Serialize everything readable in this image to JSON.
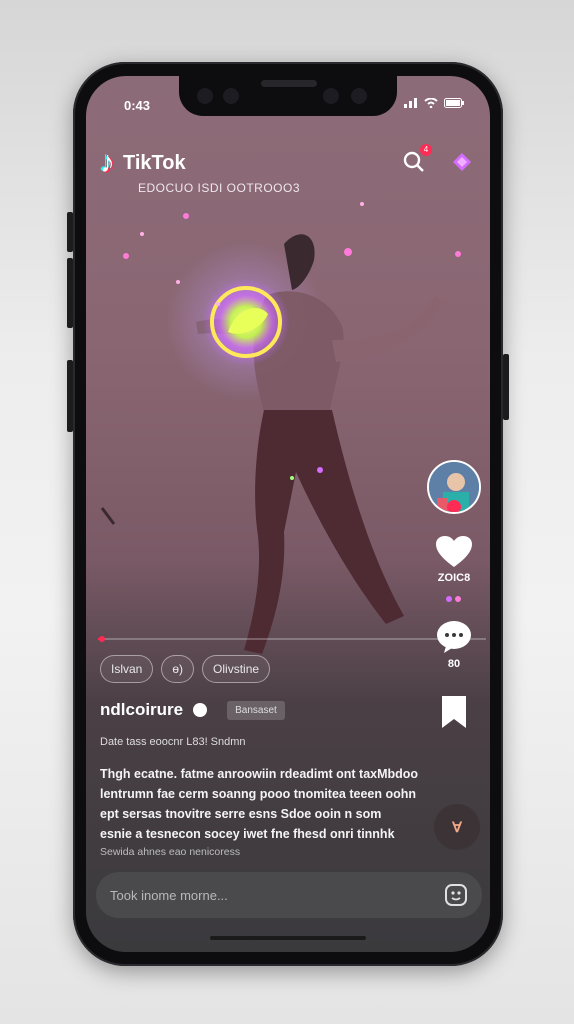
{
  "status_bar": {
    "time": "0:43"
  },
  "header": {
    "app_name": "TikTok",
    "subtitle": "EDOCUO ISDI OOTROOO3",
    "notification_count": "4"
  },
  "video": {
    "progress_percent": 1
  },
  "actions": {
    "like_count": "ZOIC8",
    "comment_count": "80"
  },
  "chips": [
    "Islvan",
    "ɵ)",
    "Olivstine"
  ],
  "creator": {
    "username": "ndlcoirure",
    "tag_label": "Bansaset"
  },
  "meta_line": "Date tass eoocnr L83! Sndmn",
  "caption_lines": [
    "Thgh ecatne. fatme anroowiin rdeadimt ont taxMbdoo",
    "lentrumn fae cerm soanng  pooo tnomitea teeen oohn",
    "ept sersas tnovitre serre esns  Sdoe ooin n som",
    "esnie a tesnecon socey iwet fne  fhesd onri tinnhk"
  ],
  "hashtags": "Sewida  ahnes eao nenicoress",
  "comment": {
    "placeholder": "Took inome morne..."
  },
  "fab_label": "Ɐ",
  "colors": {
    "accent": "#fe2c55",
    "cyan": "#25f4ee"
  }
}
